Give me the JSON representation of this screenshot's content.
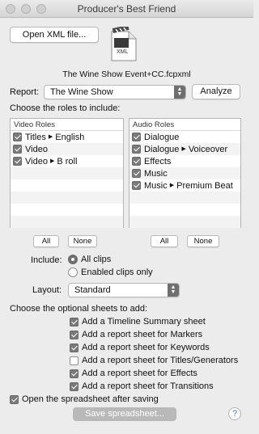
{
  "window": {
    "title": "Producer's Best Friend"
  },
  "file": {
    "open_button": "Open XML file...",
    "icon_label": "XML",
    "filename": "The Wine Show Event+CC.fcpxml"
  },
  "report": {
    "label": "Report:",
    "selected": "The Wine Show",
    "analyze_button": "Analyze"
  },
  "roles": {
    "heading": "Choose the roles to include:",
    "video": {
      "header": "Video Roles",
      "items": [
        {
          "label": "Titles",
          "sub": "English",
          "checked": true
        },
        {
          "label": "Video",
          "sub": "",
          "checked": true
        },
        {
          "label": "Video",
          "sub": "B roll",
          "checked": true
        }
      ],
      "all_button": "All",
      "none_button": "None"
    },
    "audio": {
      "header": "Audio Roles",
      "items": [
        {
          "label": "Dialogue",
          "sub": "",
          "checked": true
        },
        {
          "label": "Dialogue",
          "sub": "Voiceover",
          "checked": true
        },
        {
          "label": "Effects",
          "sub": "",
          "checked": true
        },
        {
          "label": "Music",
          "sub": "",
          "checked": true
        },
        {
          "label": "Music",
          "sub": "Premium Beat",
          "checked": true
        }
      ],
      "all_button": "All",
      "none_button": "None"
    }
  },
  "include": {
    "label": "Include:",
    "options": [
      {
        "label": "All clips",
        "selected": true
      },
      {
        "label": "Enabled clips only",
        "selected": false
      }
    ]
  },
  "layout": {
    "label": "Layout:",
    "selected": "Standard"
  },
  "sheets": {
    "heading": "Choose the optional sheets to add:",
    "items": [
      {
        "label": "Add a Timeline Summary sheet",
        "checked": true
      },
      {
        "label": "Add a report sheet for Markers",
        "checked": true
      },
      {
        "label": "Add a report sheet for Keywords",
        "checked": true
      },
      {
        "label": "Add a report sheet for Titles/Generators",
        "checked": false
      },
      {
        "label": "Add a report sheet for Effects",
        "checked": true
      },
      {
        "label": "Add a report sheet for Transitions",
        "checked": true
      }
    ]
  },
  "open_after": {
    "label": "Open the spreadsheet after saving",
    "checked": true
  },
  "save_button": "Save spreadsheet...",
  "help_button": "?"
}
